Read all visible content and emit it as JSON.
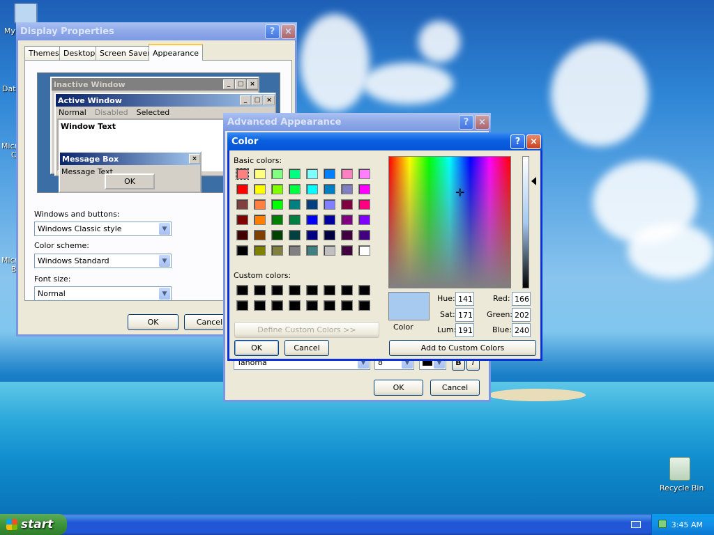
{
  "desktop": {
    "icon_labels": [
      "My",
      "Data",
      "Micro",
      "C",
      "Micro",
      "B"
    ],
    "recycle_bin": "Recycle Bin"
  },
  "display_properties": {
    "title": "Display Properties",
    "help_icon": "?",
    "close_icon": "×",
    "tabs": [
      {
        "label": "Themes"
      },
      {
        "label": "Desktop"
      },
      {
        "label": "Screen Saver"
      },
      {
        "label": "Appearance",
        "selected": true
      }
    ],
    "preview": {
      "inactive_title": "Inactive Window",
      "active_title": "Active Window",
      "menu": [
        "Normal",
        "Disabled",
        "Selected"
      ],
      "window_text": "Window Text",
      "message_title": "Message Box",
      "message_text": "Message Text",
      "ok": "OK"
    },
    "windows_buttons_label": "Windows and buttons:",
    "windows_buttons_value": "Windows Classic style",
    "color_scheme_label": "Color scheme:",
    "color_scheme_value": "Windows Standard",
    "font_size_label": "Font size:",
    "font_size_value": "Normal",
    "ok": "OK",
    "cancel": "Cancel"
  },
  "advanced_appearance": {
    "title": "Advanced Appearance",
    "font_value": "Tahoma",
    "size_value": "8",
    "bold": "B",
    "italic": "I",
    "ok": "OK",
    "cancel": "Cancel"
  },
  "color_dialog": {
    "title": "Color",
    "basic_colors_label": "Basic colors:",
    "custom_colors_label": "Custom colors:",
    "basic_colors": [
      "#ff8080",
      "#ffff80",
      "#80ff80",
      "#00ff80",
      "#80ffff",
      "#0080ff",
      "#ff80c0",
      "#ff80ff",
      "#ff0000",
      "#ffff00",
      "#80ff00",
      "#00ff40",
      "#00ffff",
      "#0080c0",
      "#8080c0",
      "#ff00ff",
      "#804040",
      "#ff8040",
      "#00ff00",
      "#008080",
      "#004080",
      "#8080ff",
      "#800040",
      "#ff0080",
      "#800000",
      "#ff8000",
      "#008000",
      "#008040",
      "#0000ff",
      "#0000a0",
      "#800080",
      "#8000ff",
      "#400000",
      "#804000",
      "#004000",
      "#004040",
      "#000080",
      "#000040",
      "#400040",
      "#400080",
      "#000000",
      "#808000",
      "#808040",
      "#808080",
      "#408080",
      "#c0c0c0",
      "#400040",
      "#ffffff"
    ],
    "custom_colors": [
      "#000000",
      "#000000",
      "#000000",
      "#000000",
      "#000000",
      "#000000",
      "#000000",
      "#000000",
      "#000000",
      "#000000",
      "#000000",
      "#000000",
      "#000000",
      "#000000",
      "#000000",
      "#000000"
    ],
    "define_custom": "Define Custom Colors >>",
    "ok": "OK",
    "cancel": "Cancel",
    "color_label": "Color",
    "selected_color": "#a6caf0",
    "hue_label": "Hue:",
    "hue": "141",
    "sat_label": "Sat:",
    "sat": "171",
    "lum_label": "Lum:",
    "lum": "191",
    "red_label": "Red:",
    "red": "166",
    "green_label": "Green:",
    "green": "202",
    "blue_label": "Blue:",
    "blue": "240",
    "add_custom": "Add to Custom Colors"
  },
  "taskbar": {
    "start": "start",
    "clock": "3:45 AM"
  }
}
